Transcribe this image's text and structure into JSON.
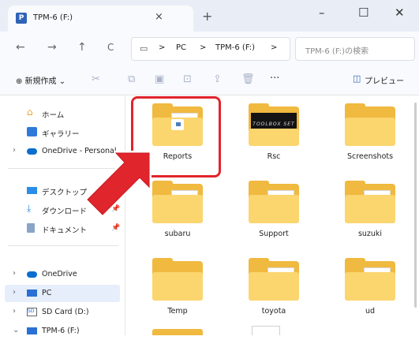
{
  "window": {
    "tab_title": "TPM-6 (F:)",
    "tab_icon_letter": "P",
    "close_tab": "×",
    "new_tab": "+",
    "minimize": "–",
    "maximize": "☐",
    "close": "✕"
  },
  "nav": {
    "back": "←",
    "forward": "→",
    "up": "↑",
    "refresh": "C",
    "breadcrumb": [
      "PC",
      "TPM-6 (F:)"
    ],
    "sep": ">",
    "search_placeholder": "TPM-6 (F:)の検索"
  },
  "toolbar": {
    "new_label": "⊕ 新規作成 ⌄",
    "more": "···",
    "preview_label": "プレビュー"
  },
  "sidebar": {
    "items": [
      {
        "label": "ホーム"
      },
      {
        "label": "ギャラリー"
      },
      {
        "label": "OneDrive - Personal"
      },
      {
        "label": "デスクトップ"
      },
      {
        "label": "ダウンロード"
      },
      {
        "label": "ドキュメント"
      },
      {
        "label": "OneDrive"
      },
      {
        "label": "PC"
      },
      {
        "label": "SD Card (D:)"
      },
      {
        "label": "TPM-6 (F:)"
      }
    ]
  },
  "folders": [
    {
      "name": "Reports"
    },
    {
      "name": "Rsc",
      "thumbnail_text": "TOOLBOX SET"
    },
    {
      "name": "Screenshots"
    },
    {
      "name": "subaru"
    },
    {
      "name": "Support"
    },
    {
      "name": "suzuki"
    },
    {
      "name": "Temp"
    },
    {
      "name": "toyota"
    },
    {
      "name": "ud"
    }
  ],
  "colors": {
    "accent": "#e1252d",
    "folder": "#f0b93f",
    "selected": "#e6eefb"
  }
}
